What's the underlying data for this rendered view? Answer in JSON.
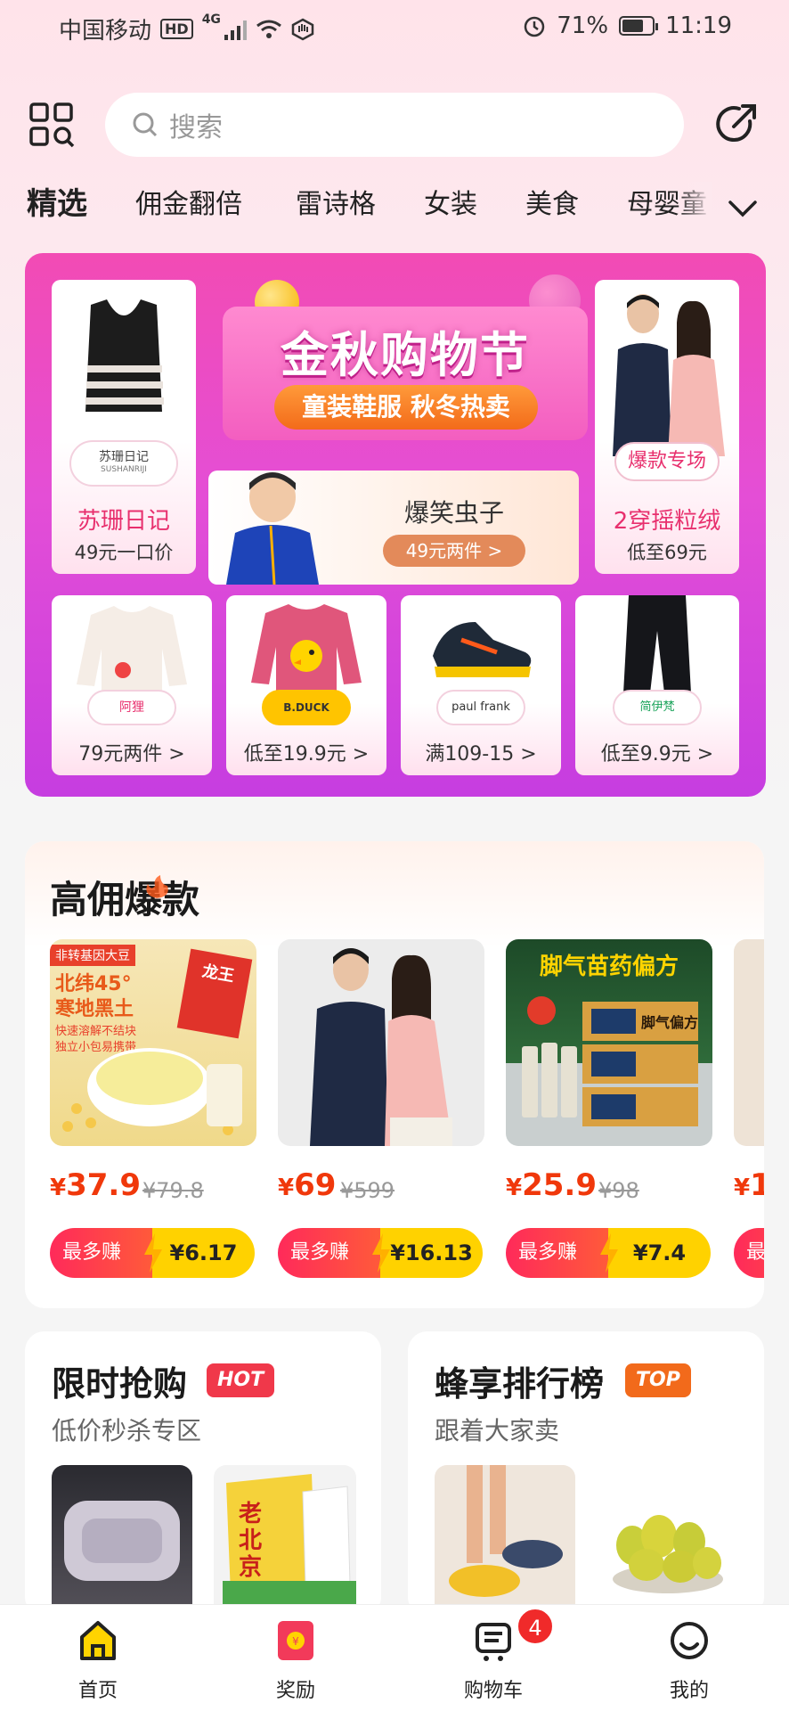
{
  "status_bar": {
    "carrier": "中国移动",
    "hd": "HD",
    "network": "4G",
    "battery": "71%",
    "battery_level": 0.71,
    "time": "11:19"
  },
  "search": {
    "placeholder": "搜索"
  },
  "tabs": [
    "精选",
    "佣金翻倍",
    "雷诗格",
    "女装",
    "美食",
    "母婴童"
  ],
  "banner": {
    "title": "金秋购物节",
    "subtitle": "童装鞋服 秋冬热卖",
    "left_card": {
      "brand": "苏珊日记",
      "logo_text": "苏珊日记",
      "logo_sub": "SUSHANRIJI",
      "price": "49元一口价"
    },
    "center_card": {
      "brand": "爆笑虫子",
      "button": "49元两件 >"
    },
    "right_card": {
      "tag": "爆款专场",
      "brand": "2穿摇粒绒",
      "price": "低至69元"
    },
    "small_cards": [
      {
        "logo": "阿狸",
        "label": "79元两件 >"
      },
      {
        "logo": "B.DUCK",
        "label": "低至19.9元 >"
      },
      {
        "logo": "paul frank",
        "label": "满109-15 >"
      },
      {
        "logo": "简伊梵",
        "label": "低至9.9元 >"
      }
    ],
    "colors": {
      "top": "#f24bb4",
      "bottom": "#c63de0"
    }
  },
  "high_commission": {
    "title": "高佣爆款",
    "products": [
      {
        "price_symbol": "¥",
        "price": "37.9",
        "original": "¥79.8",
        "earn_label": "最多赚",
        "earn": "¥6.17",
        "img_texts": {
          "tag": "非转基因大豆",
          "line1": "北纬45°",
          "line2": "寒地黑土",
          "line3": "快速溶解不结块",
          "line4": "独立小包易携带",
          "brand": "龙王"
        }
      },
      {
        "price_symbol": "¥",
        "price": "69",
        "original": "¥599",
        "earn_label": "最多赚",
        "earn": "¥16.13",
        "img_texts": {}
      },
      {
        "price_symbol": "¥",
        "price": "25.9",
        "original": "¥98",
        "earn_label": "最多赚",
        "earn": "¥7.4",
        "img_texts": {
          "title": "脚气苗药偏方",
          "box": "脚气偏方"
        }
      },
      {
        "price_symbol": "¥",
        "price": "1",
        "original": "",
        "earn_label": "最",
        "earn": "",
        "img_texts": {}
      }
    ]
  },
  "flash_sale": {
    "title": "限时抢购",
    "badge": "HOT",
    "subtitle": "低价秒杀专区",
    "img_texts": {
      "brand": "老北京"
    }
  },
  "ranking": {
    "title": "蜂享排行榜",
    "badge": "TOP",
    "subtitle": "跟着大家卖"
  },
  "bottom_nav": [
    {
      "label": "首页",
      "icon": "home-icon"
    },
    {
      "label": "奖励",
      "icon": "reward-icon"
    },
    {
      "label": "购物车",
      "icon": "cart-icon",
      "badge": "4"
    },
    {
      "label": "我的",
      "icon": "profile-icon"
    }
  ],
  "accent_colors": {
    "price": "#f0380b",
    "earn_yellow": "#ffd200",
    "hot": "#f0384a",
    "top": "#f26a1b"
  }
}
